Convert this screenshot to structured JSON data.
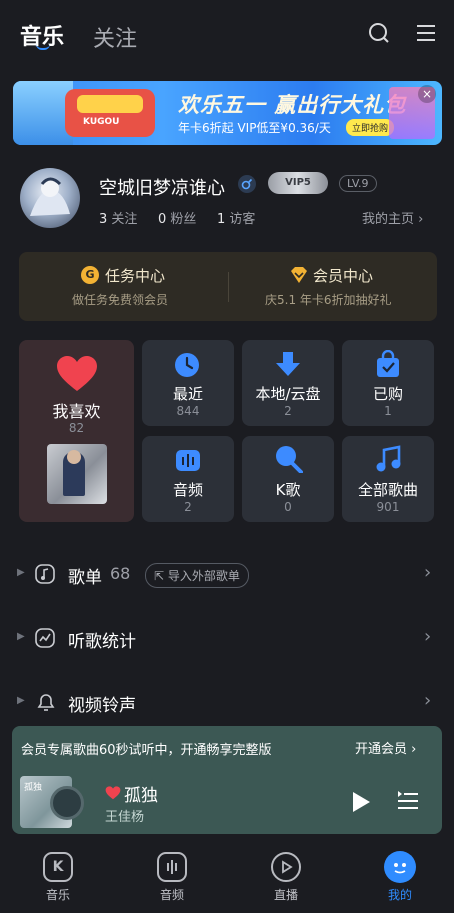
{
  "header": {
    "tabs": [
      {
        "label": "音乐",
        "active": true
      },
      {
        "label": "关注",
        "active": false
      }
    ],
    "icons": [
      "search-icon",
      "menu-icon"
    ]
  },
  "banner": {
    "title": "欢乐五一 赢出行大礼包",
    "subtitle": "年卡6折起 VIP低至¥0.36/天",
    "button": "立即抢购",
    "car_plate": "KUGOU",
    "close_icon": "close-icon"
  },
  "profile": {
    "username": "空城旧梦凉谁心",
    "vip_badge": "VIP5",
    "level": "LV.9",
    "stats": [
      {
        "count": "3",
        "label": "关注"
      },
      {
        "count": "0",
        "label": "粉丝"
      },
      {
        "count": "1",
        "label": "访客"
      }
    ],
    "homepage_link": "我的主页"
  },
  "centers": [
    {
      "title": "任务中心",
      "subtitle": "做任务免费领会员",
      "icon": "task-coin-icon"
    },
    {
      "title": "会员中心",
      "subtitle": "庆5.1 年卡6折加抽好礼",
      "icon": "vip-diamond-icon"
    }
  ],
  "library": {
    "favorite": {
      "label": "我喜欢",
      "count": "82",
      "icon": "heart-icon"
    },
    "tiles": [
      {
        "label": "最近",
        "count": "844",
        "icon": "clock-icon"
      },
      {
        "label": "本地/云盘",
        "count": "2",
        "icon": "download-arrow-icon"
      },
      {
        "label": "已购",
        "count": "1",
        "icon": "purchased-bag-icon"
      },
      {
        "label": "音频",
        "count": "2",
        "icon": "audio-wave-icon"
      },
      {
        "label": "K歌",
        "count": "0",
        "icon": "microphone-icon"
      },
      {
        "label": "全部歌曲",
        "count": "901",
        "icon": "music-note-icon"
      }
    ]
  },
  "sections": [
    {
      "title": "歌单",
      "count": "68",
      "action": "导入外部歌单",
      "icon": "playlist-icon"
    },
    {
      "title": "听歌统计",
      "icon": "stats-line-icon"
    },
    {
      "title": "视频铃声",
      "icon": "bell-icon"
    }
  ],
  "player": {
    "promo_text": "会员专属歌曲60秒试听中，开通畅享完整版",
    "promo_link": "开通会员",
    "song_title": "孤独",
    "artist": "王佳杨",
    "cover_text": "孤独"
  },
  "bottom_nav": [
    {
      "label": "音乐",
      "icon": "k-music-icon",
      "active": false
    },
    {
      "label": "音频",
      "icon": "audio-icon",
      "active": false
    },
    {
      "label": "直播",
      "icon": "live-play-icon",
      "active": false
    },
    {
      "label": "我的",
      "icon": "mine-face-icon",
      "active": true
    }
  ],
  "colors": {
    "background": "#1b1c21",
    "accent": "#2f8cff",
    "heart": "#f0434f",
    "tile_icon": "#3d8bff",
    "player_bg": "#3c5854"
  }
}
